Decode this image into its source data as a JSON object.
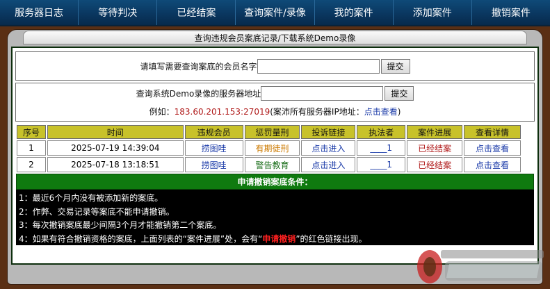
{
  "nav": [
    {
      "label": "服务器日志"
    },
    {
      "label": "等待判决"
    },
    {
      "label": "已经结案"
    },
    {
      "label": "查询案件/录像"
    },
    {
      "label": "我的案件"
    },
    {
      "label": "添加案件"
    },
    {
      "label": "撤销案件"
    }
  ],
  "panel_title": "查询违规会员案底记录/下载系统Demo录像",
  "member_query": {
    "label": "请填写需要查询案底的会员名字",
    "value": "",
    "submit": "提交"
  },
  "server_query": {
    "label": "查询系统Demo录像的服务器地址",
    "value": "",
    "submit": "提交",
    "example_prefix": "例如：",
    "example_ip": "183.60.201.153:27019",
    "example_mid": " (案沛所有服务器IP地址：",
    "example_link": "点击查看",
    "example_suffix": ")"
  },
  "table": {
    "headers": [
      "序号",
      "时间",
      "违规会员",
      "惩罚量刑",
      "投诉链接",
      "执法者",
      "案件进展",
      "查看详情"
    ],
    "rows": [
      {
        "num": "1",
        "time": "2025-07-19 14:39:04",
        "member": "捞图哇",
        "penalty": "有期徒刑",
        "complaint": "点击进入",
        "enforcer": "____1",
        "status": "已经结案",
        "detail": "点击查看"
      },
      {
        "num": "2",
        "time": "2025-07-18 13:18:51",
        "member": "捞图哇",
        "penalty": "警告教育",
        "complaint": "点击进入",
        "enforcer": "____1",
        "status": "已经结案",
        "detail": "点击查看"
      }
    ]
  },
  "conditions": {
    "title": "申请撤销案底条件：",
    "items": [
      "1：最近6个月内没有被添加新的案底。",
      "2：作弊、交易记录等案底不能申请撤销。",
      "3：每次撤销案底最少间隔3个月才能撤销第二个案底。"
    ],
    "item4_prefix": "4：如果有符合撤销资格的案底，上面列表的“案件进展”处，会有“",
    "item4_highlight": "申请撤销",
    "item4_suffix": "”的红色链接出现。"
  },
  "colors": {
    "nav_bg": "#0a3760",
    "frame_bg": "#b8b8b8",
    "header_yellow": "#c8c22a",
    "green_bar": "#0f7a0f",
    "status_red": "#b01a1a",
    "link_blue": "#1a3aa8"
  }
}
